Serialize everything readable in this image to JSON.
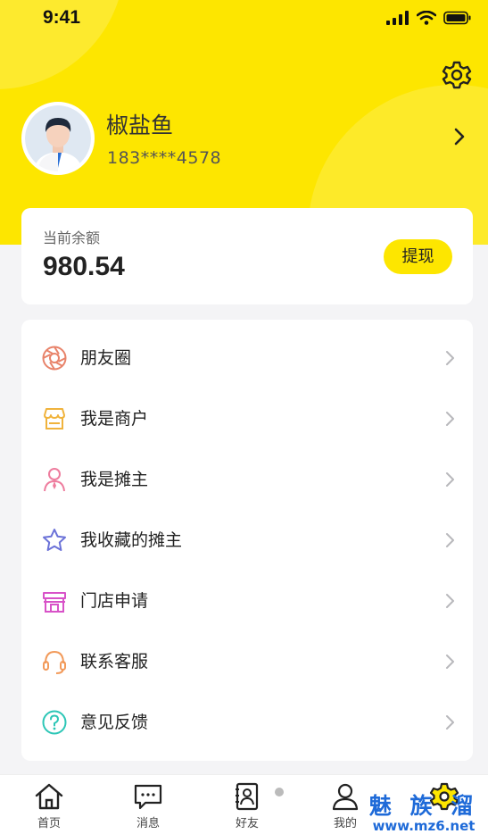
{
  "status_bar": {
    "time": "9:41"
  },
  "profile": {
    "name": "椒盐鱼",
    "phone": "183****4578"
  },
  "balance": {
    "label": "当前余额",
    "amount": "980.54",
    "withdraw_label": "提现"
  },
  "menu": {
    "items": [
      {
        "label": "朋友圈",
        "icon": "aperture-icon",
        "color": "#e8836a"
      },
      {
        "label": "我是商户",
        "icon": "store-icon",
        "color": "#f0b33c"
      },
      {
        "label": "我是摊主",
        "icon": "person-icon",
        "color": "#ee7d9e"
      },
      {
        "label": "我收藏的摊主",
        "icon": "star-icon",
        "color": "#6b72d8"
      },
      {
        "label": "门店申请",
        "icon": "shop-icon",
        "color": "#d852c8"
      },
      {
        "label": "联系客服",
        "icon": "headset-icon",
        "color": "#f29a5a"
      },
      {
        "label": "意见反馈",
        "icon": "question-icon",
        "color": "#2cc6b6"
      }
    ]
  },
  "tab_bar": {
    "tabs": [
      {
        "label": "首页",
        "icon": "home-icon"
      },
      {
        "label": "消息",
        "icon": "message-icon"
      },
      {
        "label": "好友",
        "icon": "contacts-icon"
      },
      {
        "label": "我的",
        "icon": "user-icon"
      },
      {
        "label": "",
        "icon": "gear-icon"
      }
    ]
  },
  "watermark": {
    "text": "魅 族 溜",
    "url": "www.mz6.net"
  },
  "colors": {
    "brand_yellow": "#fde600",
    "background": "#f4f4f6"
  }
}
